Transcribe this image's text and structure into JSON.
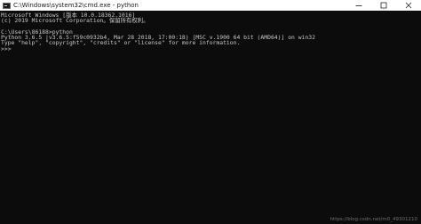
{
  "window": {
    "title": "C:\\Windows\\system32\\cmd.exe - python",
    "icon": "cmd-icon",
    "controls": [
      "minimize-icon",
      "maximize-icon",
      "close-icon"
    ]
  },
  "console": {
    "lines": [
      "Microsoft Windows [版本 10.0.18362.1016]",
      "(c) 2019 Microsoft Corporation。保留所有权利。",
      "",
      "C:\\Users\\86188>python",
      "Python 3.6.5 |v3.6.5:f59c0932b4, Mar 28 2018, 17:00:18) [MSC v.1900 64 bit (AMD64)] on win32",
      "Type \"help\", \"copyright\", \"credits\" or \"license\" for more information.",
      ">>>"
    ]
  },
  "watermark": "https://blog.csdn.net/m0_49301210"
}
